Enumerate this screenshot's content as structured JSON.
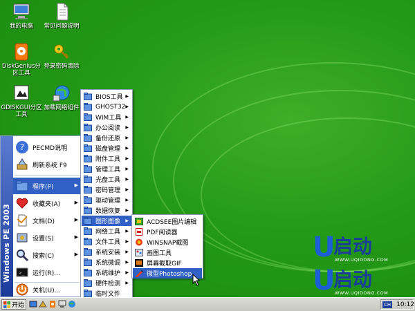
{
  "desktop_icons": [
    {
      "name": "my-computer",
      "label": "我的电脑",
      "icon": "computer-icon"
    },
    {
      "name": "faq",
      "label": "常见问题说明",
      "icon": "document-icon"
    },
    {
      "name": "diskgenius",
      "label": "DiskGenius分区工具",
      "icon": "diskgenius-icon"
    },
    {
      "name": "password-clear",
      "label": "登录密码清除",
      "icon": "key-icon"
    },
    {
      "name": "diskgui",
      "label": "GDISKGUI分区工具",
      "icon": "diskgui-icon"
    },
    {
      "name": "network-load",
      "label": "加载网络组件",
      "icon": "network-globe-icon"
    }
  ],
  "start_menu": {
    "sidebar_text": "Windows PE 2003",
    "items": [
      {
        "label": "PECMD说明",
        "icon": "help-icon"
      },
      {
        "label": "刷新系统 F9",
        "icon": "refresh-icon"
      },
      {
        "label": "程序(P)",
        "icon": "programs-icon",
        "selected": true,
        "arrow": "▶"
      },
      {
        "label": "收藏夹(A)",
        "icon": "favorites-icon",
        "arrow": "▶"
      },
      {
        "label": "文档(D)",
        "icon": "documents-icon",
        "arrow": "▶"
      },
      {
        "label": "设置(S)",
        "icon": "settings-icon",
        "arrow": "▶"
      },
      {
        "label": "搜索(C)",
        "icon": "search-icon",
        "arrow": "▶"
      },
      {
        "label": "运行(R)...",
        "icon": "run-icon"
      },
      {
        "label": "关机(U)...",
        "icon": "shutdown-icon"
      }
    ]
  },
  "programs_menu": {
    "items": [
      {
        "label": "BIOS工具"
      },
      {
        "label": "GHOST32"
      },
      {
        "label": "WIM工具"
      },
      {
        "label": "办公阅读"
      },
      {
        "label": "备份还原"
      },
      {
        "label": "磁盘管理"
      },
      {
        "label": "附件工具"
      },
      {
        "label": "管理工具"
      },
      {
        "label": "光盘工具"
      },
      {
        "label": "密码管理"
      },
      {
        "label": "驱动管理"
      },
      {
        "label": "数据恢复"
      },
      {
        "label": "图形图像",
        "selected": true
      },
      {
        "label": "网络工具"
      },
      {
        "label": "文件工具"
      },
      {
        "label": "系统安装"
      },
      {
        "label": "系统微调"
      },
      {
        "label": "系统维护"
      },
      {
        "label": "硬件检测"
      },
      {
        "label": "临时文件",
        "no_arrow": true
      },
      {
        "label": "我的工具",
        "no_arrow": true
      }
    ]
  },
  "graphics_menu": {
    "items": [
      {
        "label": "ACDSEE图片编辑",
        "icon": "acdsee-icon"
      },
      {
        "label": "PDF阅读器",
        "icon": "pdf-icon"
      },
      {
        "label": "WINSNAP截图",
        "icon": "winsnap-icon"
      },
      {
        "label": "画图工具",
        "icon": "paint-icon"
      },
      {
        "label": "屏幕截取GIF",
        "icon": "gif-capture-icon"
      },
      {
        "label": "微型Photoshop",
        "icon": "photoshop-icon",
        "selected": true
      }
    ]
  },
  "taskbar": {
    "start_label": "开始",
    "tray_badge": "CH",
    "clock": "10:12"
  },
  "watermark": {
    "logo_letter": "U",
    "logo_cn": "启动",
    "url": "WWW.UQIDONG.COM"
  },
  "colors": {
    "desktop_green": "#249a16",
    "selection_blue": "#3160c5",
    "logo_blue": "#1c5fd4"
  }
}
